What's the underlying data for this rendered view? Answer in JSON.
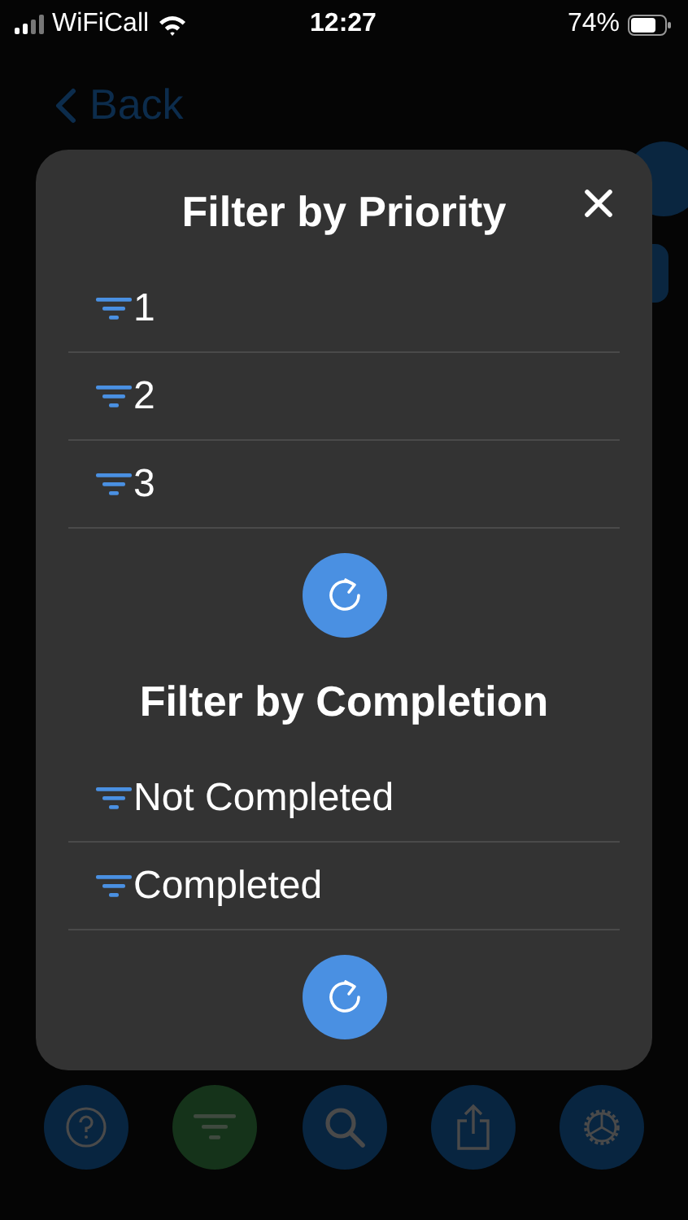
{
  "status_bar": {
    "carrier": "WiFiCall",
    "time": "12:27",
    "battery": "74%"
  },
  "background": {
    "back_label": "Back"
  },
  "modal": {
    "sections": [
      {
        "title": "Filter by Priority",
        "options": [
          "1",
          "2",
          "3"
        ]
      },
      {
        "title": "Filter by Completion",
        "options": [
          "Not Completed",
          "Completed"
        ]
      }
    ]
  },
  "tab_bar": [
    {
      "kind": "help",
      "selected": false
    },
    {
      "kind": "filter",
      "selected": true
    },
    {
      "kind": "search",
      "selected": false
    },
    {
      "kind": "share",
      "selected": false
    },
    {
      "kind": "settings",
      "selected": false
    }
  ]
}
